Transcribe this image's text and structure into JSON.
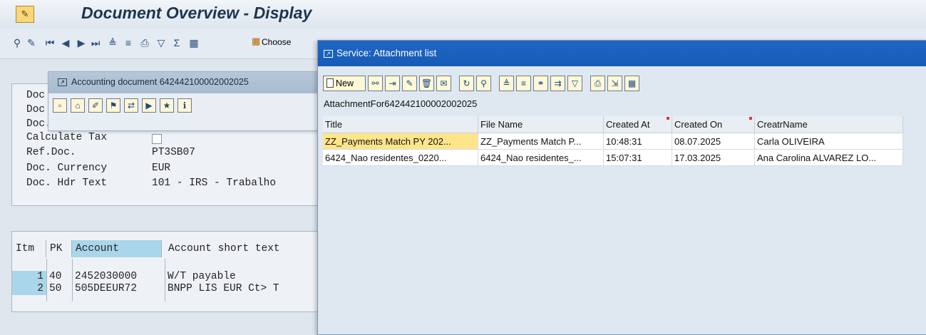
{
  "window": {
    "title": "Document Overview - Display",
    "toolbar": {
      "choose_label": "Choose"
    }
  },
  "header_fields": {
    "rows": [
      {
        "label": "Doc",
        "value": ""
      },
      {
        "label": "Doc",
        "value": ""
      },
      {
        "label": "Doc.",
        "value": ""
      },
      {
        "label": "Calculate Tax",
        "value": ""
      },
      {
        "label": "Ref.Doc.",
        "value": "PT3SB07"
      },
      {
        "label": "Doc. Currency",
        "value": "EUR"
      },
      {
        "label": "Doc. Hdr Text",
        "value": "101 - IRS - Trabalho"
      }
    ]
  },
  "items_grid": {
    "columns": [
      "Itm",
      "PK",
      "Account",
      "Account short text"
    ],
    "rows": [
      {
        "itm": "1",
        "pk": "40",
        "account": "2452030000",
        "text": "W/T payable"
      },
      {
        "itm": "2",
        "pk": "50",
        "account": "505DEEUR72",
        "text": "BNPP LIS EUR Ct> T"
      }
    ]
  },
  "accounting_popup": {
    "title": "Accounting document 642442100002002025"
  },
  "attachment_popup": {
    "title": "Service: Attachment list",
    "new_label": "New",
    "caption": "AttachmentFor642442100002002025",
    "columns": [
      "Title",
      "File Name",
      "Created At",
      "Created On",
      "CreatrName"
    ],
    "rows": [
      {
        "title": "ZZ_Payments Match PY 202...",
        "file": "ZZ_Payments Match P...",
        "at": "10:48:31",
        "on": "08.07.2025",
        "name": "Carla OLIVEIRA"
      },
      {
        "title": "6424_Nao residentes_0220...",
        "file": "6424_Nao residentes_...",
        "at": "15:07:31",
        "on": "17.03.2025",
        "name": "Ana Carolina ALVAREZ LO..."
      }
    ]
  },
  "colors": {
    "titlebar_blue": "#1e67c6",
    "selection_yellow": "#ffe58a"
  }
}
